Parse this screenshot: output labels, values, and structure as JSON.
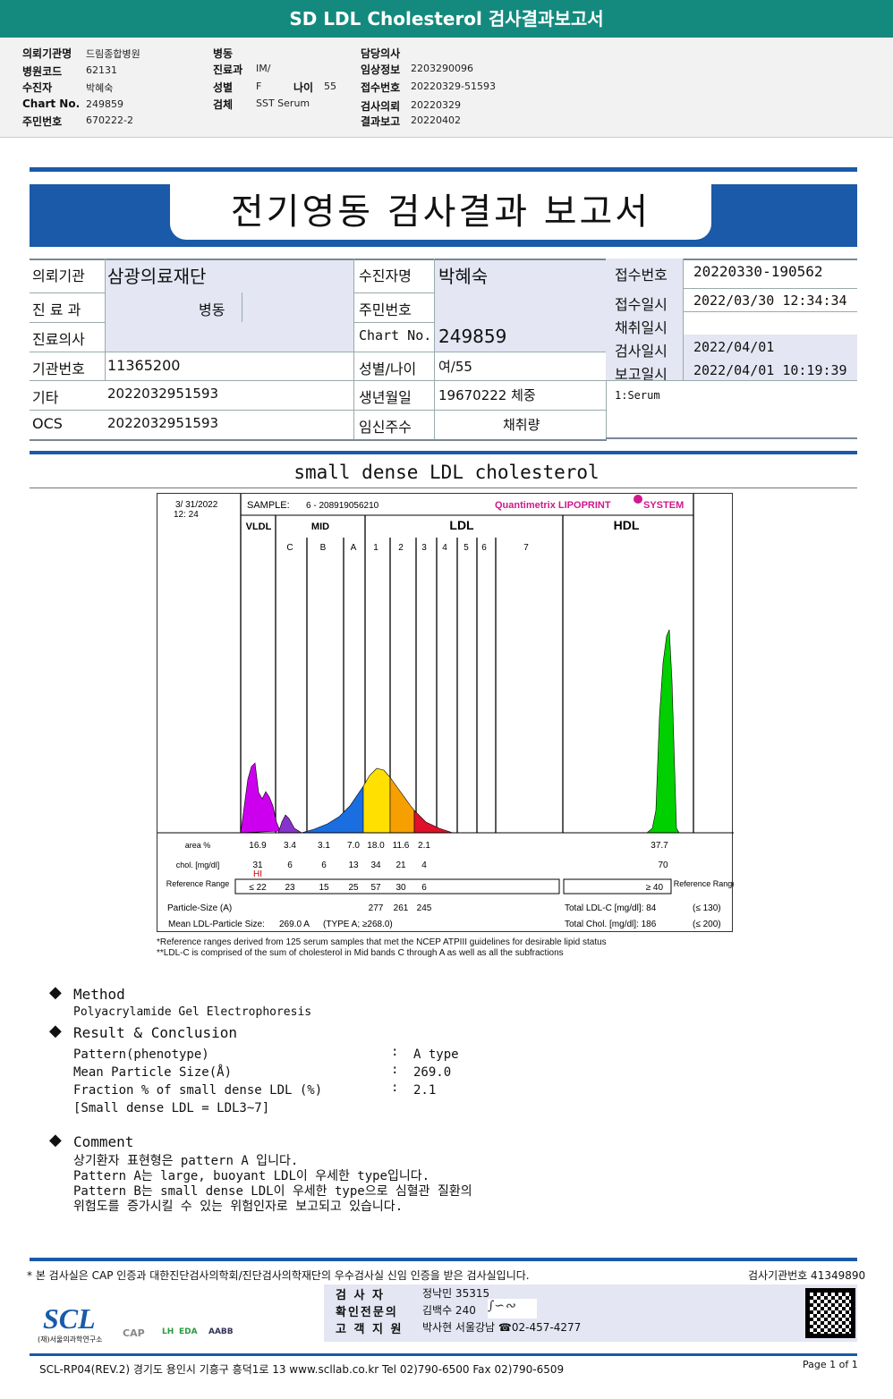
{
  "title": "SD LDL Cholesterol 검사결과보고서",
  "info": {
    "col1": [
      [
        "의뢰기관명",
        "드림종합병원"
      ],
      [
        "병원코드",
        "62131"
      ],
      [
        "수진자",
        "박혜숙"
      ],
      [
        "Chart No.",
        "249859"
      ],
      [
        "주민번호",
        "670222-2"
      ]
    ],
    "col2": [
      [
        "병동",
        ""
      ],
      [
        "진료과",
        "IM/"
      ],
      [
        "성별",
        "F"
      ],
      [
        "검체",
        "SST Serum"
      ]
    ],
    "age_label": "나이",
    "age": "55",
    "col3": [
      [
        "담당의사",
        ""
      ],
      [
        "임상정보",
        "2203290096"
      ],
      [
        "접수번호",
        "20220329-51593"
      ],
      [
        "검사의뢰",
        "20220329"
      ],
      [
        "결과보고",
        "20220402"
      ]
    ]
  },
  "report_title": "전기영동 검사결과 보고서",
  "table": {
    "r1": [
      "의뢰기관",
      "삼광의료재단",
      "수진자명",
      "박혜숙"
    ],
    "r2": [
      "진 료 과",
      "병동",
      "주민번호",
      ""
    ],
    "r3": [
      "진료의사",
      "",
      "Chart No.",
      "249859"
    ],
    "r4": [
      "기관번호",
      "11365200",
      "성별/나이",
      "여/55"
    ],
    "r5": [
      "기타",
      "2022032951593",
      "생년월일",
      "19670222 체중"
    ],
    "r6": [
      "OCS",
      "2022032951593",
      "임신주수",
      "채취량"
    ],
    "right": [
      [
        "접수번호",
        "20220330-190562"
      ],
      [
        "접수일시",
        "2022/03/30 12:34:34"
      ],
      [
        "채취일시",
        ""
      ],
      [
        "검사일시",
        "2022/04/01"
      ],
      [
        "보고일시",
        "2022/04/01 10:19:39"
      ]
    ],
    "specimen": "1:Serum"
  },
  "section_title": "small dense LDL cholesterol",
  "chart": {
    "date": "3/ 31/2022",
    "time": "12: 24",
    "sample_label": "SAMPLE:",
    "sample": "6 - 208919056210",
    "brand": "Quantimetrix LIPOPRINT",
    "brand2": "SYSTEM",
    "brand_color": "#d0198c",
    "regions": [
      "VLDL",
      "MID",
      "LDL",
      "HDL"
    ],
    "bands": [
      "C",
      "B",
      "A",
      "1",
      "2",
      "3",
      "4",
      "5",
      "6",
      "7"
    ],
    "row_labels": {
      "area": "area %",
      "chol": "chol. [mg/dl]",
      "ref": "Reference Range",
      "ref2": "Reference Range",
      "psize": "Particle-Size (A)",
      "mean": "Mean LDL-Particle Size:"
    },
    "area": [
      "16.9",
      "3.4",
      "3.1",
      "7.0",
      "18.0",
      "11.6",
      "2.1"
    ],
    "area_hdl": "37.7",
    "chol": [
      "31",
      "6",
      "6",
      "13",
      "34",
      "21",
      "4"
    ],
    "chol_hdl": "70",
    "hi": "HI",
    "ref": [
      "≤ 22",
      "23",
      "15",
      "25",
      "57",
      "30",
      "6"
    ],
    "ref_hdl": "≥ 40",
    "psize": [
      "277",
      "261",
      "245"
    ],
    "mean": "269.0 A",
    "type": "(TYPE A; ≥268.0)",
    "total_ldl": "Total LDL-C [mg/dl]:  84",
    "total_ldl_ref": "(≤ 130)",
    "total_chol": "Total Chol. [mg/dl]:   186",
    "total_chol_ref": "(≤ 200)",
    "note1": "*Reference ranges derived from 125 serum samples that met the NCEP ATPIII guidelines for desirable lipid status",
    "note2": "**LDL-C is comprised of the sum of cholesterol in Mid bands C through A as well as all the subfractions",
    "colors": {
      "vldl": "#cc00ee",
      "mid": "#8833cc",
      "blue": "#1a6ee0",
      "yellow": "#ffe000",
      "orange": "#f5a000",
      "red": "#e0102a",
      "hdl": "#00d000"
    }
  },
  "method": {
    "title": "Method",
    "text": "Polyacrylamide Gel Electrophoresis"
  },
  "result": {
    "title": "Result & Conclusion",
    "rows": [
      [
        "Pattern(phenotype)",
        ":",
        "A type"
      ],
      [
        "Mean Particle Size(Å)",
        ":",
        "269.0"
      ],
      [
        "Fraction % of small dense LDL (%)",
        ":",
        "2.1"
      ]
    ],
    "note": "[Small dense LDL = LDL3~7]"
  },
  "comment": {
    "title": "Comment",
    "lines": [
      "상기환자 표현형은 pattern A 입니다.",
      "Pattern A는 large, buoyant LDL이 우세한 type입니다.",
      "Pattern B는 small dense LDL이 우세한 type으로 심혈관 질환의",
      "위험도를 증가시킬 수 있는 위험인자로 보고되고 있습니다."
    ]
  },
  "footer": {
    "cert": "* 본 검사실은 CAP 인증과 대한진단검사의학회/진단검사의학재단의 우수검사실 신임 인증을 받은 검사실입니다.",
    "lab_no": "검사기관번호 41349890",
    "staff": [
      [
        "검  사  자",
        "정낙민 35315"
      ],
      [
        "확인전문의",
        "김백수 240"
      ],
      [
        "고 객 지 원",
        "박사현 서울강남 ☎02-457-4277"
      ]
    ],
    "logo": "SCL",
    "logo_sub": "(재)서울의과학연구소",
    "cert_logos": [
      "CAP",
      "LH",
      "EDA",
      "AABB"
    ],
    "address": "SCL-RP04(REV.2)  경기도 용인시 기흥구 흥덕1로 13  www.scllab.co.kr   Tel 02)790-6500   Fax 02)790-6509",
    "page": "Page 1 of 1"
  }
}
